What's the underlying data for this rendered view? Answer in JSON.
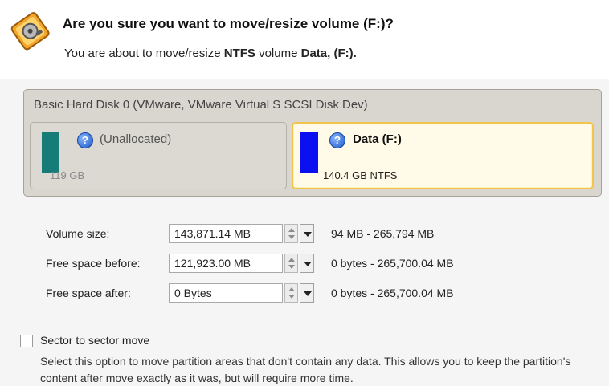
{
  "header": {
    "title": "Are you sure you want to move/resize volume (F:)?",
    "sub_prefix": "You are about to move/resize",
    "fs_type": "NTFS",
    "sub_middle": "volume",
    "volume_label": "Data, (F:).",
    "icon": "move-resize-volume-icon"
  },
  "disk": {
    "title": "Basic Hard Disk 0 (VMware, VMware Virtual S SCSI Disk Dev)",
    "partitions": [
      {
        "name": "(Unallocated)",
        "info": "119 GB",
        "color": "#167c78",
        "selected": false
      },
      {
        "name": "Data (F:)",
        "info": "140.4 GB NTFS",
        "color": "#0a10f0",
        "selected": true
      }
    ]
  },
  "form": {
    "rows": [
      {
        "label": "Volume size:",
        "value": "143,871.14 MB",
        "range": "94 MB - 265,794 MB"
      },
      {
        "label": "Free space before:",
        "value": "121,923.00 MB",
        "range": "0 bytes - 265,700.04 MB"
      },
      {
        "label": "Free space after:",
        "value": "0 Bytes",
        "range": "0 bytes - 265,700.04 MB"
      }
    ]
  },
  "sector": {
    "checked": false,
    "label": "Sector to sector move",
    "description": "Select this option to move partition areas that don't contain any data. This allows you to keep the partition's content after move exactly as it was, but will require more time."
  },
  "colors": {
    "accent_border": "#f3c44b",
    "unallocated": "#167c78",
    "data_partition": "#0a10f0"
  }
}
